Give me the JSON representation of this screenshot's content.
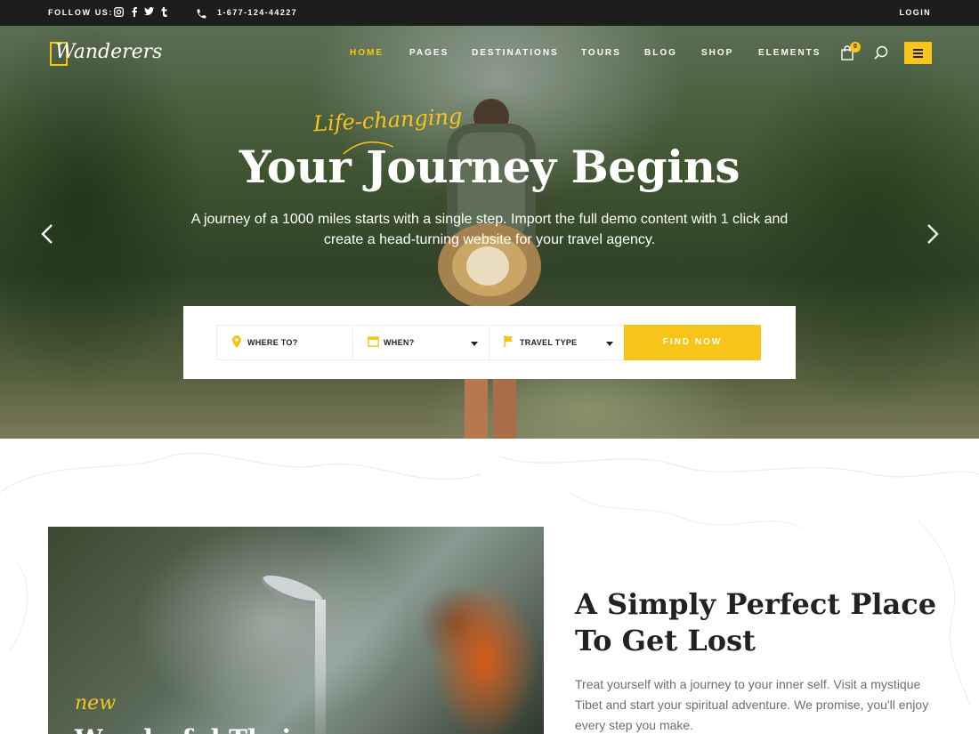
{
  "topbar": {
    "follow_label": "FOLLOW US:",
    "social": [
      {
        "name": "instagram-icon",
        "glyph": "◘"
      },
      {
        "name": "facebook-icon",
        "glyph": "f"
      },
      {
        "name": "twitter-icon",
        "glyph": "t"
      },
      {
        "name": "tumblr-icon",
        "glyph": "t"
      }
    ],
    "phone": "1-677-124-44227",
    "login": "LOGIN"
  },
  "brand": {
    "logo_text": "Wanderers",
    "accent": "#f7c518"
  },
  "nav": {
    "items": [
      "HOME",
      "PAGES",
      "DESTINATIONS",
      "TOURS",
      "BLOG",
      "SHOP",
      "ELEMENTS"
    ],
    "active": "HOME",
    "cart_count": "0"
  },
  "hero": {
    "tagline": "Life-changing",
    "headline": "Your Journey Begins",
    "subtext": "A journey of a 1000 miles starts with a single step. Import the full demo content with 1 click and create a head-turning website for your travel agency."
  },
  "search": {
    "fields": [
      {
        "label": "WHERE TO?",
        "icon": "map-pin-icon",
        "dropdown": false
      },
      {
        "label": "WHEN?",
        "icon": "calendar-icon",
        "dropdown": true
      },
      {
        "label": "TRAVEL TYPE",
        "icon": "flag-icon",
        "dropdown": true
      }
    ],
    "button": "FIND NOW"
  },
  "feature": {
    "badge": "new",
    "cut_title": "Wonderful Thai"
  },
  "intro": {
    "title": "A Simply Perfect Place To Get Lost",
    "text": "Treat yourself with a journey to your inner self. Visit a mystique Tibet and start your spiritual adventure. We promise, you'll enjoy every step you make."
  }
}
